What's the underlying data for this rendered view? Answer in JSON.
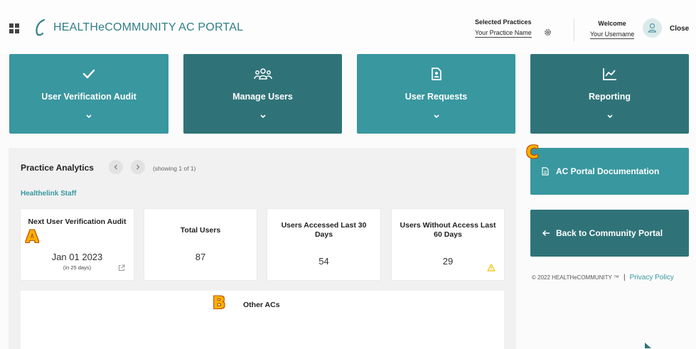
{
  "header": {
    "brand": "HEALTHeCOMMUNITY AC PORTAL",
    "selected_practices_label": "Selected Practices",
    "practice_name": "Your Practice Name",
    "welcome_label": "Welcome",
    "username": "Your Username",
    "close_label": "Close"
  },
  "tiles": [
    {
      "label": "User Verification Audit",
      "icon": "check-icon"
    },
    {
      "label": "Manage Users",
      "icon": "users-icon"
    },
    {
      "label": "User Requests",
      "icon": "document-user-icon"
    },
    {
      "label": "Reporting",
      "icon": "chart-icon"
    }
  ],
  "analytics": {
    "title": "Practice Analytics",
    "showing": "(showing 1 of 1)",
    "staff_label": "Healthelink Staff",
    "cards": [
      {
        "title": "Next User Verification Audit",
        "value": "Jan 01 2023",
        "sub": "(in 25 days)"
      },
      {
        "title": "Total Users",
        "value": "87"
      },
      {
        "title": "Users Accessed Last 30 Days",
        "value": "54"
      },
      {
        "title": "Users Without Access Last 60 Days",
        "value": "29"
      }
    ],
    "other_title": "Other ACs"
  },
  "side": {
    "doc_label": "AC Portal Documentation",
    "back_label": "Back to Community Portal"
  },
  "footer": {
    "copyright": "© 2022 HEALTHeCOMMUNITY ™",
    "separator": "|",
    "privacy": "Privacy Policy"
  },
  "markers": {
    "a": "A",
    "b": "B",
    "c": "C"
  },
  "colors": {
    "teal_light": "#39979f",
    "teal_dark": "#2f7378",
    "warning": "#f2c200"
  }
}
